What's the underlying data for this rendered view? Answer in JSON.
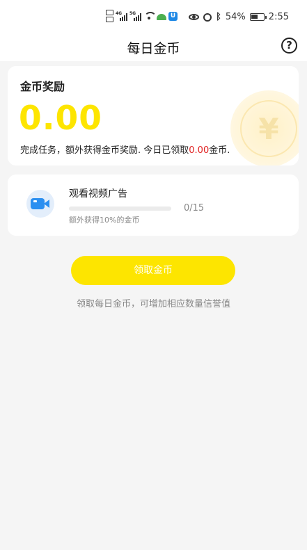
{
  "status_bar": {
    "signal_labels": [
      "4G",
      "5G"
    ],
    "battery": "54%",
    "battery_level": 0.54,
    "time": "2:55"
  },
  "header": {
    "title": "每日金币",
    "help_icon": "question-circle-icon"
  },
  "reward": {
    "title": "金币奖励",
    "amount": "0.00",
    "desc_prefix": "完成任务，额外获得金币奖励. 今日已领取",
    "desc_value": "0.00",
    "desc_suffix": "金币.",
    "value_color": "#e02020",
    "amount_color": "#fde500"
  },
  "task": {
    "icon": "video-camera-icon",
    "title": "观看视频广告",
    "progress_count": "0/15",
    "progress_fraction": 0,
    "subtitle": "额外获得10%的金币"
  },
  "claim": {
    "button_label": "领取金币",
    "hint": "领取每日金币，可增加相应数量信誉值",
    "accent": "#fde500"
  }
}
